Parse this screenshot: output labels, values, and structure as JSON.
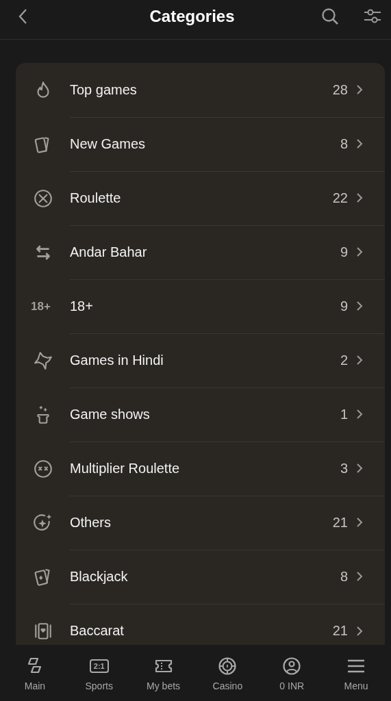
{
  "header": {
    "title": "Categories"
  },
  "categories": [
    {
      "kind": "flame",
      "label": "Top games",
      "count": "28"
    },
    {
      "kind": "cards",
      "label": "New Games",
      "count": "8"
    },
    {
      "kind": "roulette",
      "label": "Roulette",
      "count": "22"
    },
    {
      "kind": "swap",
      "label": "Andar Bahar",
      "count": "9"
    },
    {
      "kind": "badge",
      "icon_text": "18+",
      "label": "18+",
      "count": "9"
    },
    {
      "kind": "map",
      "label": "Games in Hindi",
      "count": "2"
    },
    {
      "kind": "hat",
      "label": "Game shows",
      "count": "1"
    },
    {
      "kind": "multiplier",
      "label": "Multiplier Roulette",
      "count": "3"
    },
    {
      "kind": "sparkle",
      "label": "Others",
      "count": "21"
    },
    {
      "kind": "blackjack",
      "label": "Blackjack",
      "count": "8"
    },
    {
      "kind": "baccarat",
      "label": "Baccarat",
      "count": "21"
    }
  ],
  "bottom_nav": [
    {
      "kind": "main",
      "label": "Main"
    },
    {
      "kind": "score",
      "icon_text": "2:1",
      "label": "Sports"
    },
    {
      "kind": "ticket",
      "label": "My bets"
    },
    {
      "kind": "chip",
      "label": "Casino"
    },
    {
      "kind": "user",
      "label": "0 INR"
    },
    {
      "kind": "menu",
      "label": "Menu"
    }
  ]
}
